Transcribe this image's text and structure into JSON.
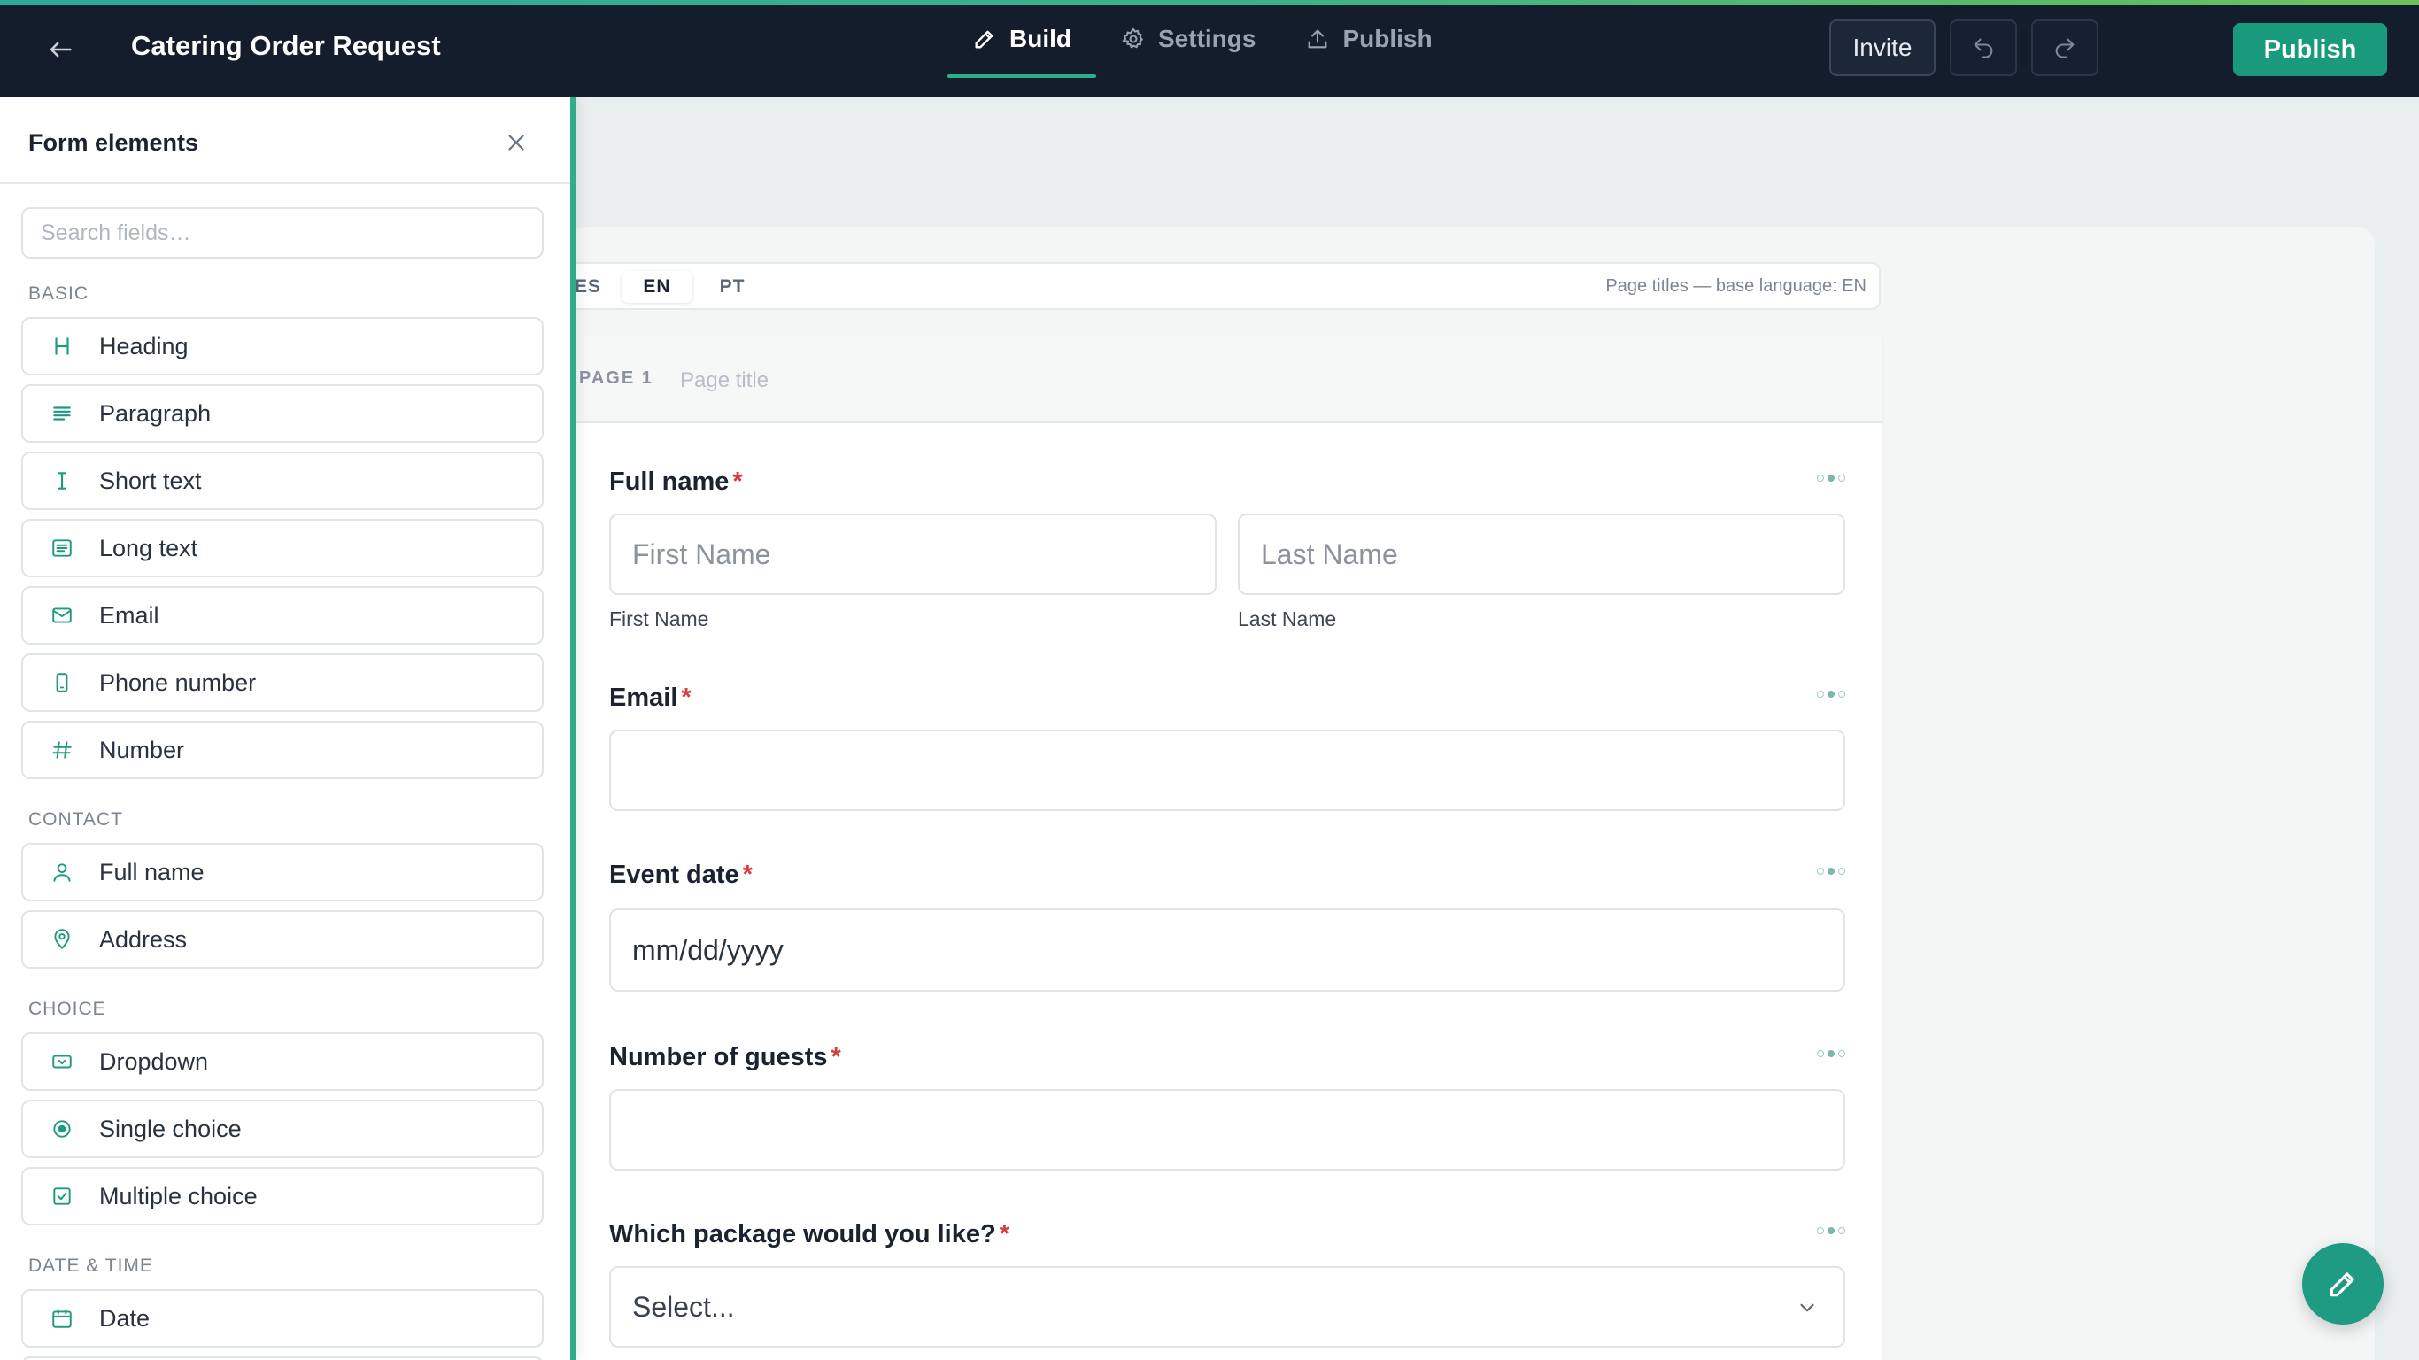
{
  "header": {
    "title": "Catering Order Request",
    "tabs": [
      {
        "label": "Build",
        "icon": "pencil-icon",
        "active": true
      },
      {
        "label": "Settings",
        "icon": "gear-icon",
        "active": false
      },
      {
        "label": "Publish",
        "icon": "upload-icon",
        "active": false
      }
    ],
    "invite_label": "Invite",
    "publish_label": "Publish"
  },
  "panel": {
    "title": "Form elements",
    "search_placeholder": "Search fields…",
    "sections": [
      {
        "label": "BASIC",
        "items": [
          {
            "label": "Heading",
            "icon": "heading-icon"
          },
          {
            "label": "Paragraph",
            "icon": "paragraph-icon"
          },
          {
            "label": "Short text",
            "icon": "text-cursor-icon"
          },
          {
            "label": "Long text",
            "icon": "long-text-icon"
          },
          {
            "label": "Email",
            "icon": "mail-icon"
          },
          {
            "label": "Phone number",
            "icon": "phone-icon"
          },
          {
            "label": "Number",
            "icon": "hash-icon"
          }
        ]
      },
      {
        "label": "CONTACT",
        "items": [
          {
            "label": "Full name",
            "icon": "user-icon"
          },
          {
            "label": "Address",
            "icon": "map-pin-icon"
          }
        ]
      },
      {
        "label": "CHOICE",
        "items": [
          {
            "label": "Dropdown",
            "icon": "dropdown-icon"
          },
          {
            "label": "Single choice",
            "icon": "radio-icon"
          },
          {
            "label": "Multiple choice",
            "icon": "checkbox-icon"
          }
        ]
      },
      {
        "label": "DATE & TIME",
        "items": [
          {
            "label": "Date",
            "icon": "calendar-icon"
          }
        ]
      }
    ]
  },
  "languages": {
    "items": [
      "ES",
      "EN",
      "PT"
    ],
    "active": "EN",
    "note": "Page titles — base language: EN"
  },
  "page": {
    "tag": "PAGE 1",
    "title_placeholder": "Page title"
  },
  "fields": {
    "full_name": {
      "label": "Full name",
      "first_placeholder": "First Name",
      "last_placeholder": "Last Name",
      "first_sublabel": "First Name",
      "last_sublabel": "Last Name"
    },
    "email": {
      "label": "Email",
      "value": ""
    },
    "event_date": {
      "label": "Event date",
      "placeholder": "mm/dd/yyyy"
    },
    "guests": {
      "label": "Number of guests",
      "value": ""
    },
    "package": {
      "label": "Which package would you like?",
      "placeholder": "Select..."
    }
  },
  "required_marker": "*",
  "colors": {
    "topbar": "#141d2b",
    "accent": "#2fae8c",
    "publish": "#1a9a7c",
    "required": "#d83b3b"
  }
}
